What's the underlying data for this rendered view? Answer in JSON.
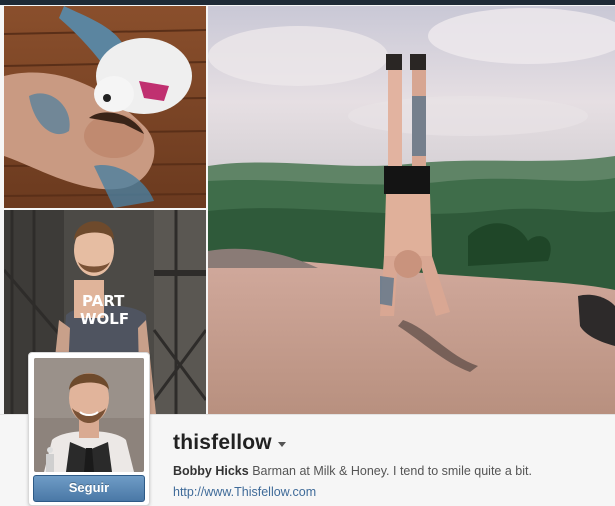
{
  "profile": {
    "username": "thisfellow",
    "full_name": "Bobby Hicks",
    "bio": "Barman at Milk & Honey. I tend to smile quite a bit.",
    "website": "http://www.Thisfellow.com",
    "follow_label": "Seguir"
  },
  "photos": {
    "shirt_text_line1": "PART",
    "shirt_text_line2": "WOLF"
  },
  "icons": {
    "username_menu": "chevron-down-icon"
  },
  "colors": {
    "follow_button": "#4a78a6",
    "link": "#3f6b99",
    "username": "#222222"
  }
}
